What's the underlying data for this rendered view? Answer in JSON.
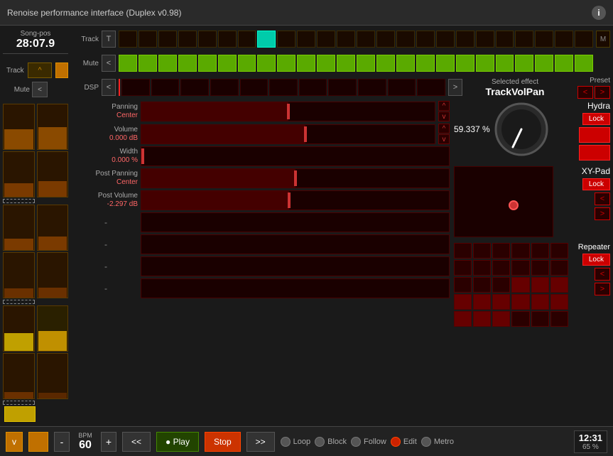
{
  "titlebar": {
    "title": "Renoise performance interface (Duplex v0.98)",
    "info_label": "i"
  },
  "song_pos": {
    "label": "Song-pos",
    "value": "28:07.9"
  },
  "track_row": {
    "label": "Track",
    "nav_left": "T",
    "nav_right": "M",
    "active_cell": 7
  },
  "mute_row": {
    "label": "Mute",
    "nav": "<"
  },
  "dsp_row": {
    "label": "DSP",
    "nav_left": "<",
    "nav_right": ">",
    "selected_effect_label": "Selected effect",
    "selected_effect": "TrackVolPan",
    "preset_label": "Preset"
  },
  "params": {
    "panning": {
      "label": "Panning",
      "value": "Center",
      "thumb_pct": 50
    },
    "volume": {
      "label": "Volume",
      "value": "0.000 dB",
      "thumb_pct": 56
    },
    "width": {
      "label": "Width",
      "value": "0.000 %",
      "thumb_pct": 0
    },
    "post_panning": {
      "label": "Post Panning",
      "value": "Center",
      "thumb_pct": 50
    },
    "post_volume": {
      "label": "Post Volume",
      "value": "-2.297 dB",
      "thumb_pct": 48
    }
  },
  "knob": {
    "value": "59.337 %"
  },
  "hydra": {
    "label": "Hydra",
    "lock_label": "Lock"
  },
  "xy_pad": {
    "label": "XY-Pad",
    "lock_label": "Lock",
    "nav_up": "<",
    "nav_down": ">"
  },
  "repeater": {
    "label": "Repeater",
    "lock_label": "Lock",
    "nav_up": "<",
    "nav_down": ">"
  },
  "bottom": {
    "bpm_label": "BPM",
    "bpm_value": "60",
    "minus": "-",
    "plus": "+",
    "rewind": "<<",
    "play": "● Play",
    "stop": "Stop",
    "forward": ">>",
    "loop": "Loop",
    "block": "Block",
    "follow": "Follow",
    "edit": "Edit",
    "metro": "Metro",
    "time": "12:31",
    "zoom": "65 %",
    "v_label": "v"
  }
}
